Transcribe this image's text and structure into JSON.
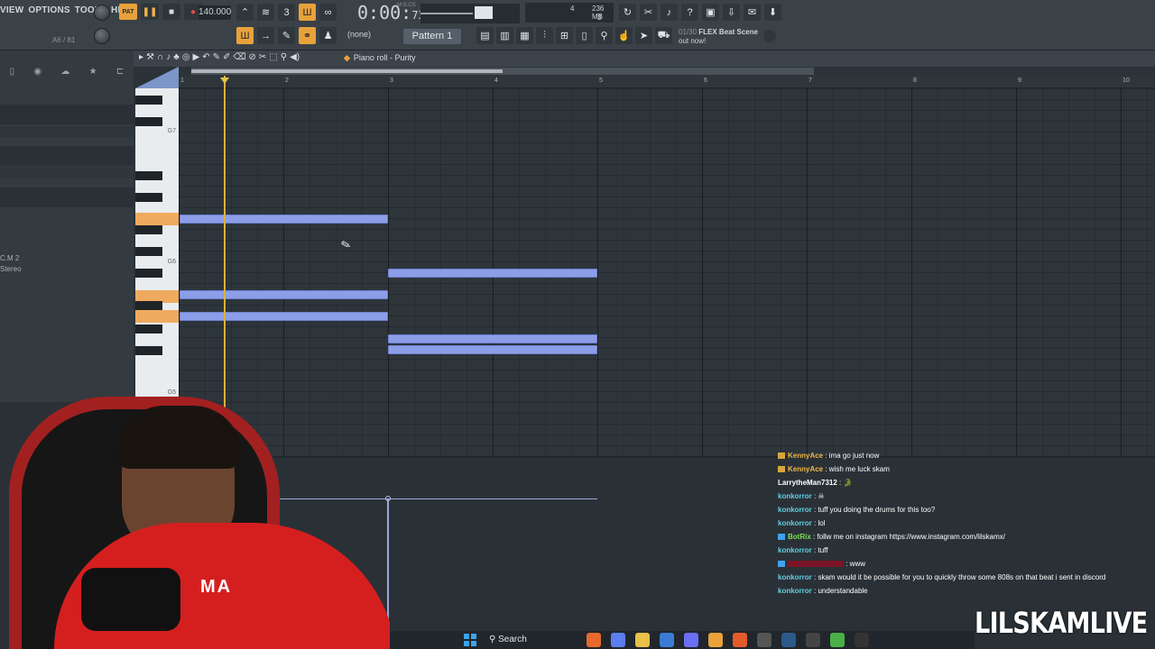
{
  "menu": [
    "VIEW",
    "OPTIONS",
    "TOOLS",
    "HELP"
  ],
  "hint_text": "A6 / 81",
  "transport": {
    "pat_label": "PAT",
    "tempo": "140.000",
    "time": "0:00",
    "time_frac": "73",
    "time_unit": "M:S:CS"
  },
  "cpu": {
    "value1": "4",
    "memory": "236 MB",
    "value3": "3"
  },
  "toolbar": {
    "none_select": "(none)",
    "pattern": "Pattern 1"
  },
  "news": {
    "count": "01/30",
    "title": "FLEX Beat Scene",
    "subtitle": "out now!"
  },
  "piano_roll": {
    "title": "Piano roll - Purity"
  },
  "ruler": [
    "1",
    "2",
    "3",
    "4",
    "5",
    "6",
    "7",
    "8",
    "9",
    "10"
  ],
  "key_labels": [
    "G7",
    "G6",
    "G5"
  ],
  "channel": {
    "name": "C.M 2",
    "mode": "Stereo"
  },
  "chat": [
    {
      "user": "KennyAce",
      "text": "ima go just now",
      "color": "#f0b84a",
      "badge": true
    },
    {
      "user": "KennyAce",
      "text": "wish me luck skam",
      "color": "#f0b84a",
      "badge": true
    },
    {
      "user": "LarrytheMan7312",
      "text": "",
      "color": "#ffffff",
      "badge": false
    },
    {
      "user": "konkorror",
      "text": "",
      "color": "#5fd0e6",
      "badge": false
    },
    {
      "user": "konkorror",
      "text": "tuff you doing the drums for this too?",
      "color": "#5fd0e6",
      "badge": false
    },
    {
      "user": "konkorror",
      "text": "lol",
      "color": "#5fd0e6",
      "badge": false
    },
    {
      "user": "BotRix",
      "text": "follw me on instagram https://www.instagram.com/lilskamx/",
      "color": "#7be05a",
      "badge": true
    },
    {
      "user": "konkorror",
      "text": "tuff",
      "color": "#5fd0e6",
      "badge": false
    },
    {
      "user": "",
      "text": "www",
      "color": "#c0203a",
      "badge": true
    },
    {
      "user": "konkorror",
      "text": "skam would it be possible for you to quickly throw some 808s on that beat i sent in discord",
      "color": "#5fd0e6",
      "badge": false
    },
    {
      "user": "konkorror",
      "text": "understandable",
      "color": "#5fd0e6",
      "badge": false
    }
  ],
  "taskbar": {
    "search": "Search"
  },
  "webcam": {
    "hoodie_text": "MA"
  },
  "watermark": "LILSKAMLIVE",
  "colors": {
    "accent": "#e8a23c",
    "note": "#8d9ee9",
    "playhead": "#d8b23a"
  }
}
